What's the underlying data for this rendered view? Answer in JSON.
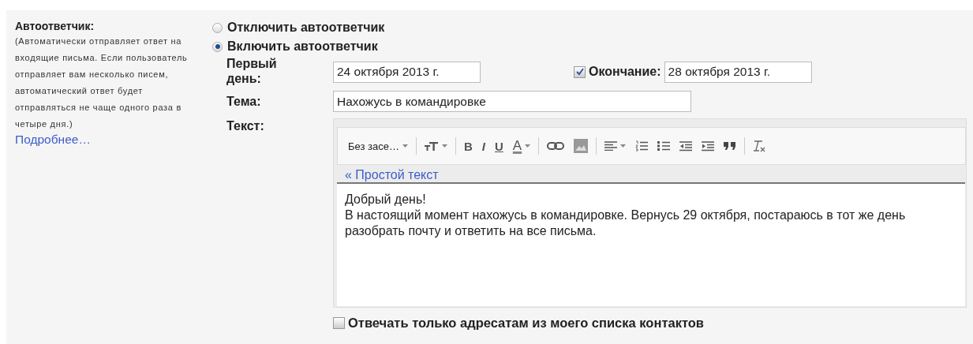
{
  "section": {
    "title": "Автоответчик:",
    "description": "(Автоматически отправляет ответ на входящие письма. Если пользователь отправляет вам несколько писем, автоматический ответ будет отправляться не чаще одного раза в четыре дня.)",
    "link": "Подробнее…"
  },
  "options": [
    {
      "label": "Отключить автоответчик",
      "selected": false
    },
    {
      "label": "Включить автоответчик",
      "selected": true
    }
  ],
  "first_day": {
    "label": "Первый день:",
    "value": "24 октября 2013 г."
  },
  "end_date": {
    "label": "Окончание:",
    "checked": true,
    "value": "28 октября 2013 г."
  },
  "subject": {
    "label": "Тема:",
    "value": "Нахожусь в командировке"
  },
  "body": {
    "label": "Текст:",
    "plain_text_link": "« Простой текст",
    "lines": [
      "Добрый день!",
      "В настоящий момент нахожусь в командировке. Вернусь 29 октября, постараюсь в тот же день разобрать почту и ответить на все письма."
    ]
  },
  "toolbar": {
    "font": "Без засе…",
    "bold": "B",
    "italic": "I",
    "underline": "U",
    "text_color_letter": "A"
  },
  "contacts_only": {
    "label": "Отвечать только адресатам из моего списка контактов",
    "checked": false
  }
}
